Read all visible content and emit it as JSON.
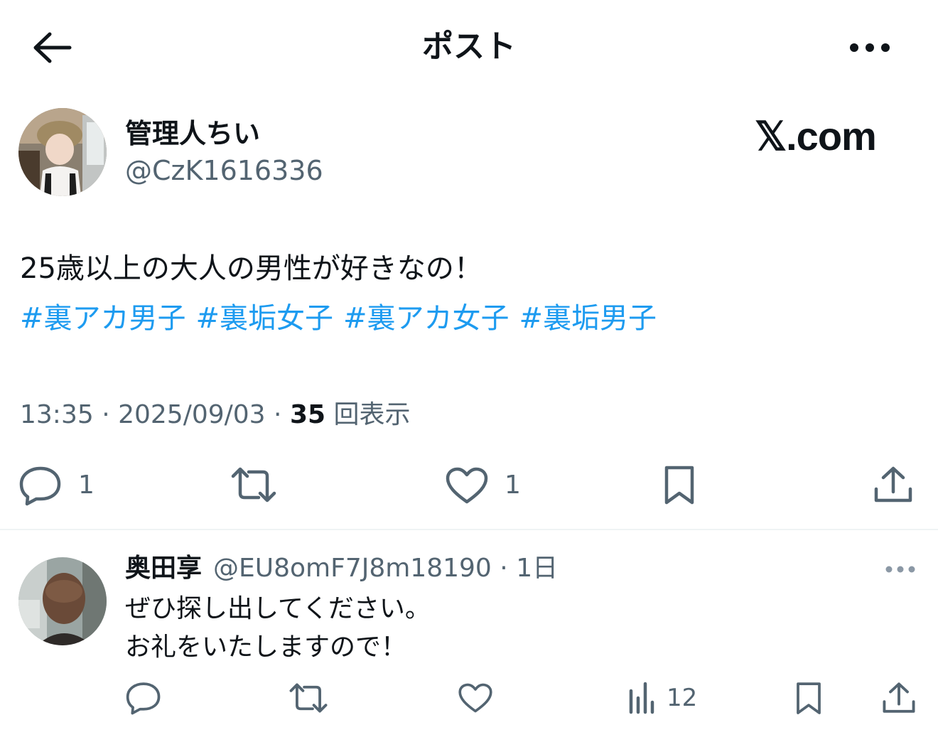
{
  "header": {
    "title": "ポスト"
  },
  "post": {
    "author_name": "管理人ちい",
    "author_handle": "@CzK1616336",
    "watermark": "𝕏.com",
    "text": "25歳以上の大人の男性が好きなの！",
    "hashtags": [
      "#裏アカ男子",
      "#裏垢女子",
      "#裏アカ女子",
      "#裏垢男子"
    ],
    "time": "13:35",
    "date": "2025/09/03",
    "views_count": "35",
    "views_label": "回表示",
    "actions": {
      "replies": "1",
      "likes": "1"
    }
  },
  "reply": {
    "author_name": "奥田享",
    "author_handle": "@EU8omF7J8m18190",
    "age": "1日",
    "lines": [
      "ぜひ探し出してください。",
      "お礼をいたしますので！"
    ],
    "actions": {
      "views": "12"
    }
  },
  "colors": {
    "link": "#1d9bf0",
    "muted": "#536471",
    "text": "#0f1419",
    "divider": "#eff3f4"
  }
}
